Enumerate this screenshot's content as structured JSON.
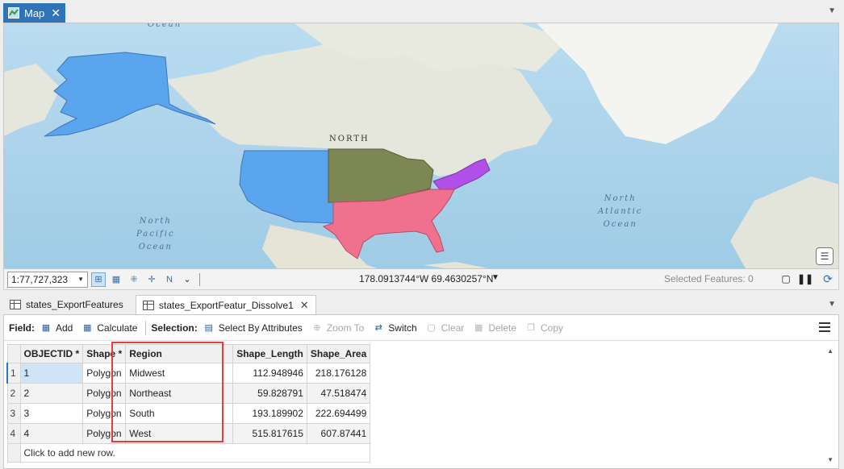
{
  "map_tab": {
    "label": "Map",
    "close": "✕"
  },
  "map": {
    "labels": {
      "ocean_top": "Ocean",
      "north": "NORTH",
      "pacific": [
        "North",
        "Pacific",
        "Ocean"
      ],
      "atlantic": [
        "North",
        "Atlantic",
        "Ocean"
      ]
    },
    "region_colors": {
      "west": "#5aa5ee",
      "midwest": "#7c8753",
      "northeast": "#b150e8",
      "south": "#f0708e",
      "alaska": "#5aa5ee"
    }
  },
  "status_bar": {
    "scale": "1:77,727,323",
    "coordinates": "178.0913744°W 69.4630257°N",
    "selected_features": "Selected Features: 0"
  },
  "attr_tabs": [
    {
      "label": "states_ExportFeatures"
    },
    {
      "label": "states_ExportFeatur_Dissolve1",
      "close": "✕"
    }
  ],
  "toolbar": {
    "field_label": "Field:",
    "add": "Add",
    "calculate": "Calculate",
    "selection_label": "Selection:",
    "select_by_attributes": "Select By Attributes",
    "zoom_to": "Zoom To",
    "switch": "Switch",
    "clear": "Clear",
    "delete": "Delete",
    "copy": "Copy"
  },
  "table": {
    "columns": [
      "OBJECTID *",
      "Shape *",
      "Region",
      "Shape_Length",
      "Shape_Area"
    ],
    "rows": [
      {
        "n": "1",
        "id": "1",
        "shape": "Polygon",
        "region": "Midwest",
        "length": "112.948946",
        "area": "218.176128"
      },
      {
        "n": "2",
        "id": "2",
        "shape": "Polygon",
        "region": "Northeast",
        "length": "59.828791",
        "area": "47.518474"
      },
      {
        "n": "3",
        "id": "3",
        "shape": "Polygon",
        "region": "South",
        "length": "193.189902",
        "area": "222.694499"
      },
      {
        "n": "4",
        "id": "4",
        "shape": "Polygon",
        "region": "West",
        "length": "515.817615",
        "area": "607.87441"
      }
    ],
    "add_row": "Click to add new row."
  }
}
